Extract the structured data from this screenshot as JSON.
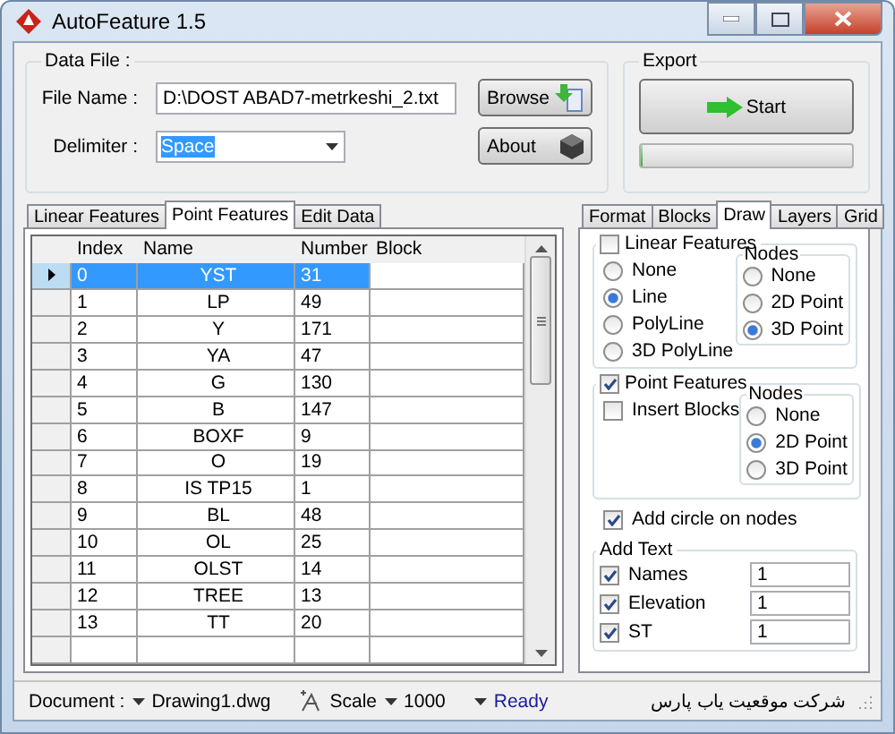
{
  "window": {
    "title": "AutoFeature 1.5"
  },
  "data_file": {
    "title": "Data File :",
    "file_name_label": "File Name :",
    "file_name": "D:\\DOST ABAD7-metrkeshi_2.txt",
    "delimiter_label": "Delimiter :",
    "delimiter": "Space",
    "browse": "Browse",
    "about": "About"
  },
  "export": {
    "title": "Export",
    "start": "Start",
    "level": 0
  },
  "left_tabs": [
    {
      "label": "Linear Features",
      "selected": false
    },
    {
      "label": "Point Features",
      "selected": true
    },
    {
      "label": "Edit Data",
      "selected": false
    }
  ],
  "table": {
    "columns": [
      "Index",
      "Name",
      "Number",
      "Block"
    ],
    "rows": [
      {
        "index": "0",
        "name": "YST",
        "number": "31",
        "selected": true
      },
      {
        "index": "1",
        "name": "LP",
        "number": "49",
        "selected": false
      },
      {
        "index": "2",
        "name": "Y",
        "number": "171",
        "selected": false
      },
      {
        "index": "3",
        "name": "YA",
        "number": "47",
        "selected": false
      },
      {
        "index": "4",
        "name": "G",
        "number": "130",
        "selected": false
      },
      {
        "index": "5",
        "name": "B",
        "number": "147",
        "selected": false
      },
      {
        "index": "6",
        "name": "BOXF",
        "number": "9",
        "selected": false
      },
      {
        "index": "7",
        "name": "O",
        "number": "19",
        "selected": false
      },
      {
        "index": "8",
        "name": "IS TP15",
        "number": "1",
        "selected": false
      },
      {
        "index": "9",
        "name": "BL",
        "number": "48",
        "selected": false
      },
      {
        "index": "10",
        "name": "OL",
        "number": "25",
        "selected": false
      },
      {
        "index": "11",
        "name": "OLST",
        "number": "14",
        "selected": false
      },
      {
        "index": "12",
        "name": "TREE",
        "number": "13",
        "selected": false
      },
      {
        "index": "13",
        "name": "TT",
        "number": "20",
        "selected": false
      }
    ]
  },
  "right_tabs": [
    {
      "label": "Format",
      "selected": false
    },
    {
      "label": "Blocks",
      "selected": false
    },
    {
      "label": "Draw",
      "selected": true
    },
    {
      "label": "Layers",
      "selected": false
    },
    {
      "label": "Grid",
      "selected": false
    }
  ],
  "draw": {
    "linear": {
      "label": "Linear Features",
      "checked": false,
      "options": [
        {
          "label": "None",
          "selected": false
        },
        {
          "label": "Line",
          "selected": true
        },
        {
          "label": "PolyLine",
          "selected": false
        },
        {
          "label": "3D PolyLine",
          "selected": false
        }
      ],
      "nodes": {
        "title": "Nodes",
        "options": [
          {
            "label": "None",
            "selected": false
          },
          {
            "label": "2D Point",
            "selected": false
          },
          {
            "label": "3D Point",
            "selected": true
          }
        ]
      }
    },
    "point": {
      "label": "Point Features",
      "checked": true,
      "insert_blocks": {
        "label": "Insert Blocks",
        "checked": false
      },
      "nodes": {
        "title": "Nodes",
        "options": [
          {
            "label": "None",
            "selected": false
          },
          {
            "label": "2D Point",
            "selected": true
          },
          {
            "label": "3D Point",
            "selected": false
          }
        ]
      }
    },
    "add_circle": {
      "label": "Add circle on nodes",
      "checked": true
    },
    "add_text": {
      "title": "Add Text",
      "items": [
        {
          "label": "Names",
          "checked": true,
          "value": "1"
        },
        {
          "label": "Elevation",
          "checked": true,
          "value": "1"
        },
        {
          "label": "ST",
          "checked": true,
          "value": "1"
        }
      ]
    }
  },
  "status_bar": {
    "document_label": "Document :",
    "document": "Drawing1.dwg",
    "scale_label": "Scale",
    "scale": "1000",
    "status": "Ready",
    "company": "شرکت موقعیت یاب پارس"
  }
}
